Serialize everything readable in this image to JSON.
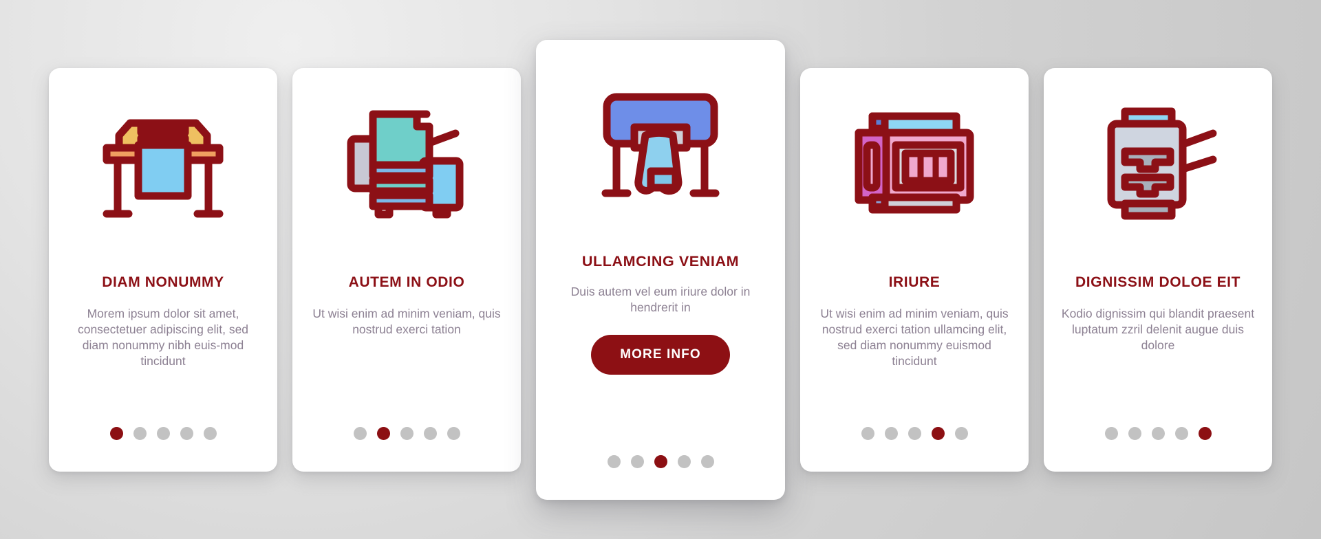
{
  "theme": {
    "accent": "#8c1016",
    "button_bg": "#8d1014",
    "button_text": "#ffffff",
    "body_text": "#8d8193",
    "dot_inactive": "#c2c2c2",
    "dot_active": "#8c0f13",
    "card_bg": "#ffffff",
    "page_bg": "#d0d0d0"
  },
  "cards": [
    {
      "icon": "plotter-wide-format-printer-icon",
      "title": "DIAM NONUMMY",
      "body": "Morem ipsum dolor sit amet, consectetuer adipiscing elit, sed diam nonummy nibh euis-mod tincidunt",
      "dots": {
        "count": 5,
        "active_index": 1
      },
      "featured": false
    },
    {
      "icon": "multifunction-copier-icon",
      "title": "AUTEM IN ODIO",
      "body": "Ut wisi enim ad minim veniam, quis nostrud exerci tation",
      "dots": {
        "count": 5,
        "active_index": 2
      },
      "featured": false
    },
    {
      "icon": "large-format-printer-with-paper-icon",
      "title": "ULLAMCING VENIAM",
      "body": "Duis autem vel eum iriure dolor in hendrerit in",
      "button_label": "MORE INFO",
      "dots": {
        "count": 5,
        "active_index": 3
      },
      "featured": true
    },
    {
      "icon": "flatbed-scanner-printer-icon",
      "title": "IRIURE",
      "body": "Ut wisi enim ad minim veniam, quis nostrud exerci tation ullamcing elit, sed diam nonummy euismod tincidunt",
      "dots": {
        "count": 5,
        "active_index": 4
      },
      "featured": false
    },
    {
      "icon": "office-copier-with-trays-icon",
      "title": "DIGNISSIM DOLOE EIT",
      "body": "Kodio dignissim qui blandit praesent luptatum zzril delenit augue duis dolore",
      "dots": {
        "count": 5,
        "active_index": 5
      },
      "featured": false
    }
  ]
}
